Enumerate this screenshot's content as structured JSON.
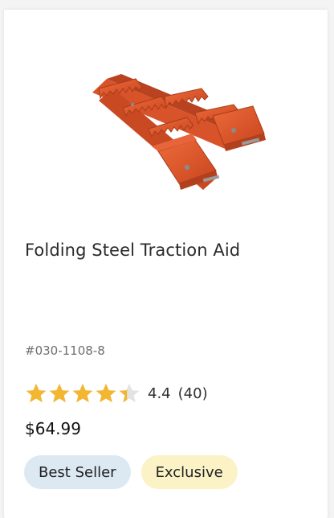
{
  "product": {
    "image_alt": "Folding steel traction aid, orange",
    "title": "Folding Steel Traction Aid",
    "sku": "#030-1108-8",
    "rating": {
      "value": "4.4",
      "count": "(40)",
      "stars_filled": 4.4,
      "stars_total": 5
    },
    "price": "$64.99",
    "badges": [
      {
        "label": "Best Seller"
      },
      {
        "label": "Exclusive"
      }
    ]
  },
  "colors": {
    "star_fill": "#f2b630",
    "star_empty": "#e3e3e3",
    "product_orange": "#e0562a",
    "badge_best_bg": "#dce8f2",
    "badge_exclusive_bg": "#fbf2c6"
  }
}
